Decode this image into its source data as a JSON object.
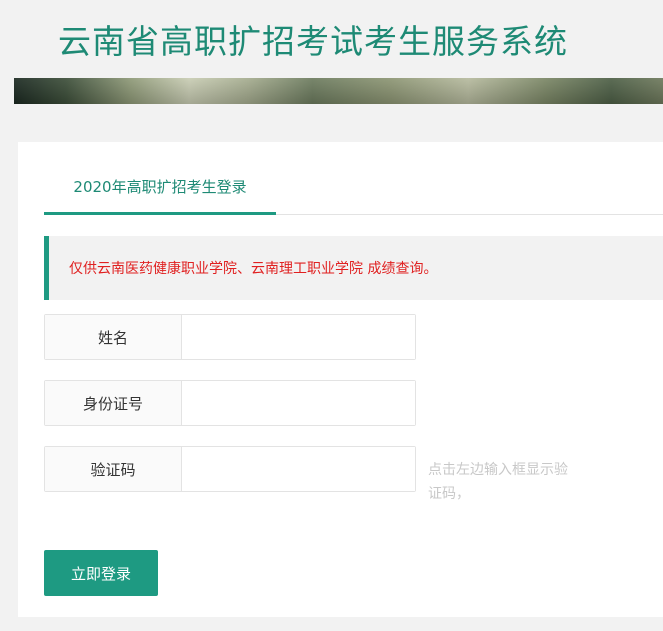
{
  "header": {
    "title": "云南省高职扩招考试考生服务系统"
  },
  "tabs": [
    {
      "label": "2020年高职扩招考生登录",
      "active": true
    }
  ],
  "notice": "仅供云南医药健康职业学院、云南理工职业学院 成绩查询。",
  "form": {
    "name_label": "姓名",
    "name_value": "",
    "id_label": "身份证号",
    "id_value": "",
    "captcha_label": "验证码",
    "captcha_value": "",
    "captcha_hint": "点击左边输入框显示验证码，",
    "submit_label": "立即登录"
  },
  "colors": {
    "accent": "#1e9a82",
    "title": "#1e8a75",
    "notice_text": "#e02020"
  }
}
